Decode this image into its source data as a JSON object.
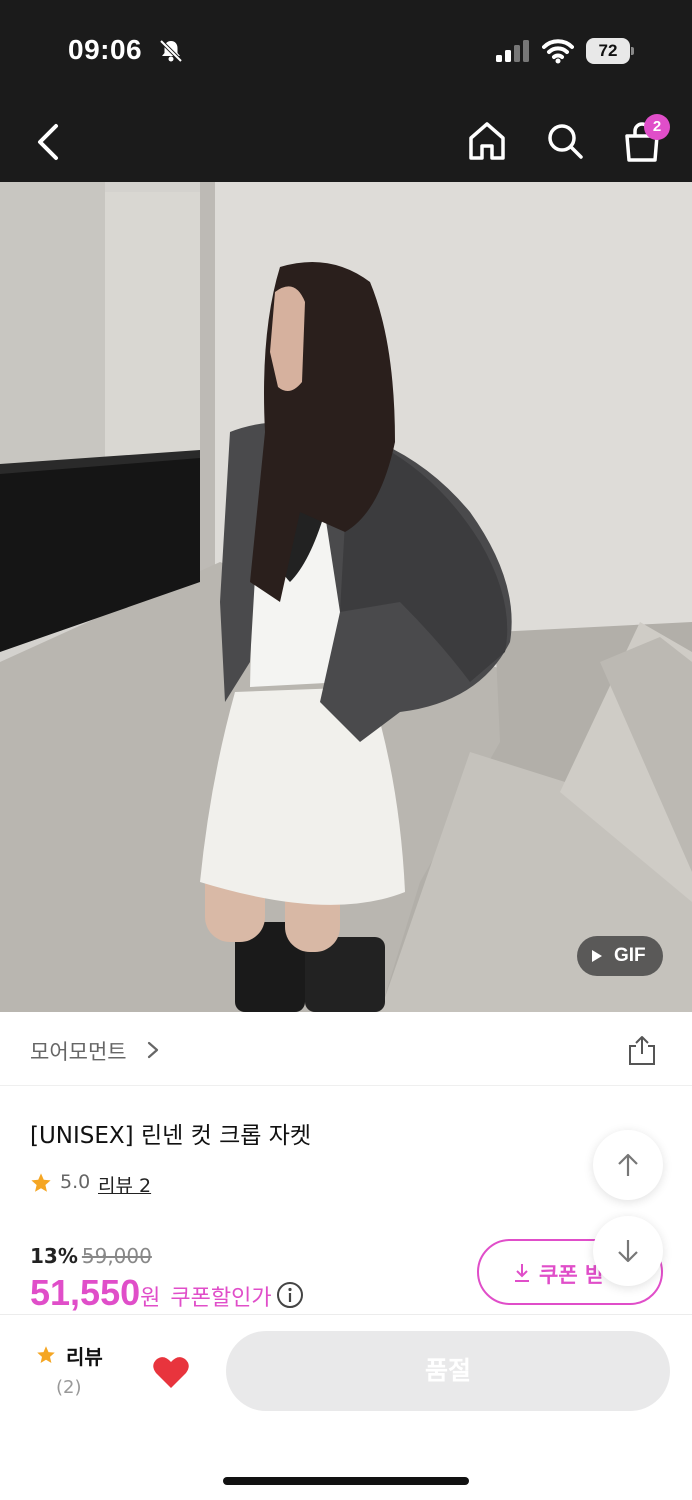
{
  "status_bar": {
    "time": "09:06",
    "battery": "72",
    "icons": [
      "bell-slash-icon",
      "signal-icon",
      "wifi-icon",
      "battery-icon"
    ]
  },
  "nav": {
    "icons": [
      "back-icon",
      "home-icon",
      "search-icon",
      "cart-icon"
    ],
    "cart_count": "2"
  },
  "media": {
    "gif_label": "GIF"
  },
  "brand": {
    "name": "모어모먼트"
  },
  "product": {
    "title": "[UNISEX] 린넨 컷 크롭 자켓",
    "rating": "5.0",
    "review_link": "리뷰 2",
    "discount_rate": "13%",
    "original_price": "59,000",
    "sale_price": "51,550",
    "currency": "원",
    "coupon_price_label": "쿠폰할인가"
  },
  "coupon_button": {
    "label": "쿠폰 받"
  },
  "bottom_bar": {
    "review_label": "리뷰",
    "review_count": "(2)",
    "soldout_label": "품절"
  },
  "colors": {
    "accent": "#e04ec9",
    "star": "#f5a623",
    "heart": "#e8343d",
    "dark_bar": "#1b1b1b"
  }
}
